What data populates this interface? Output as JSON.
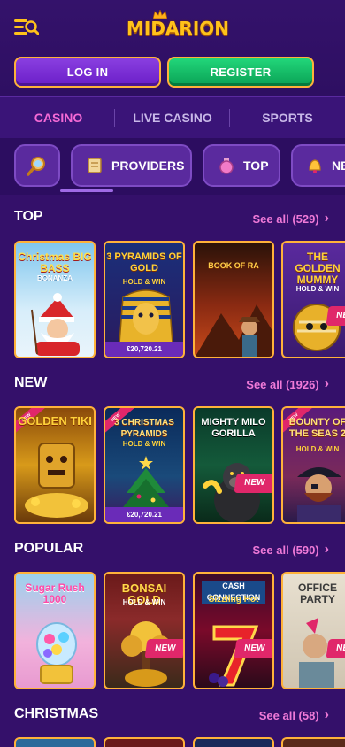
{
  "header": {
    "logo_text": "MIDARION",
    "login_label": "LOG IN",
    "register_label": "REGISTER"
  },
  "tabs": [
    {
      "label": "CASINO",
      "active": true
    },
    {
      "label": "LIVE CASINO",
      "active": false
    },
    {
      "label": "SPORTS",
      "active": false
    }
  ],
  "chips": [
    {
      "label": "",
      "icon": "search-icon"
    },
    {
      "label": "PROVIDERS",
      "icon": "scroll-icon"
    },
    {
      "label": "TOP",
      "icon": "potion-icon"
    },
    {
      "label": "NE",
      "icon": "bell-icon"
    }
  ],
  "sections": [
    {
      "title": "TOP",
      "see_all": "See all (529)",
      "games": [
        {
          "title": "Christmas BIG BASS",
          "subtitle": "BONANZA",
          "jackpot": "",
          "new": false
        },
        {
          "title": "3 PYRAMIDS OF GOLD",
          "subtitle": "HOLD & WIN",
          "jackpot": "€20,720.21",
          "new": false
        },
        {
          "title": "BOOK OF RA",
          "subtitle": "",
          "jackpot": "",
          "new": false
        },
        {
          "title": "THE GOLDEN MUMMY",
          "subtitle": "HOLD & WIN",
          "jackpot": "",
          "new": true
        }
      ]
    },
    {
      "title": "NEW",
      "see_all": "See all (1926)",
      "games": [
        {
          "title": "GOLDEN TIKI",
          "subtitle": "",
          "jackpot": "",
          "new": false,
          "ribbon": true
        },
        {
          "title": "3 CHRISTMAS PYRAMIDS",
          "subtitle": "HOLD & WIN",
          "jackpot": "€20,720.21",
          "new": false,
          "ribbon": true
        },
        {
          "title": "MIGHTY MILO GORILLA",
          "subtitle": "",
          "jackpot": "",
          "new": true
        },
        {
          "title": "BOUNTY OF THE SEAS 2",
          "subtitle": "HOLD & WIN",
          "jackpot": "",
          "new": false,
          "ribbon": true
        }
      ]
    },
    {
      "title": "POPULAR",
      "see_all": "See all (590)",
      "games": [
        {
          "title": "Sugar Rush 1000",
          "subtitle": "",
          "jackpot": "",
          "new": false
        },
        {
          "title": "BONSAI GOLD",
          "subtitle": "HOLD & WIN",
          "jackpot": "",
          "new": true
        },
        {
          "title": "CASH CONNECTION",
          "subtitle": "Sizzling Hot",
          "jackpot": "",
          "new": true
        },
        {
          "title": "OFFICE PARTY",
          "subtitle": "",
          "jackpot": "",
          "new": true
        }
      ]
    },
    {
      "title": "CHRISTMAS",
      "see_all": "See all (58)",
      "games": []
    }
  ],
  "badge_new": "NEW",
  "colors": {
    "background": "#34106a",
    "accent_pink": "#f07ad8",
    "gold_border": "#ffb23a",
    "login": "#7a30d8",
    "register": "#18c46a",
    "new_badge": "#e0276a"
  }
}
